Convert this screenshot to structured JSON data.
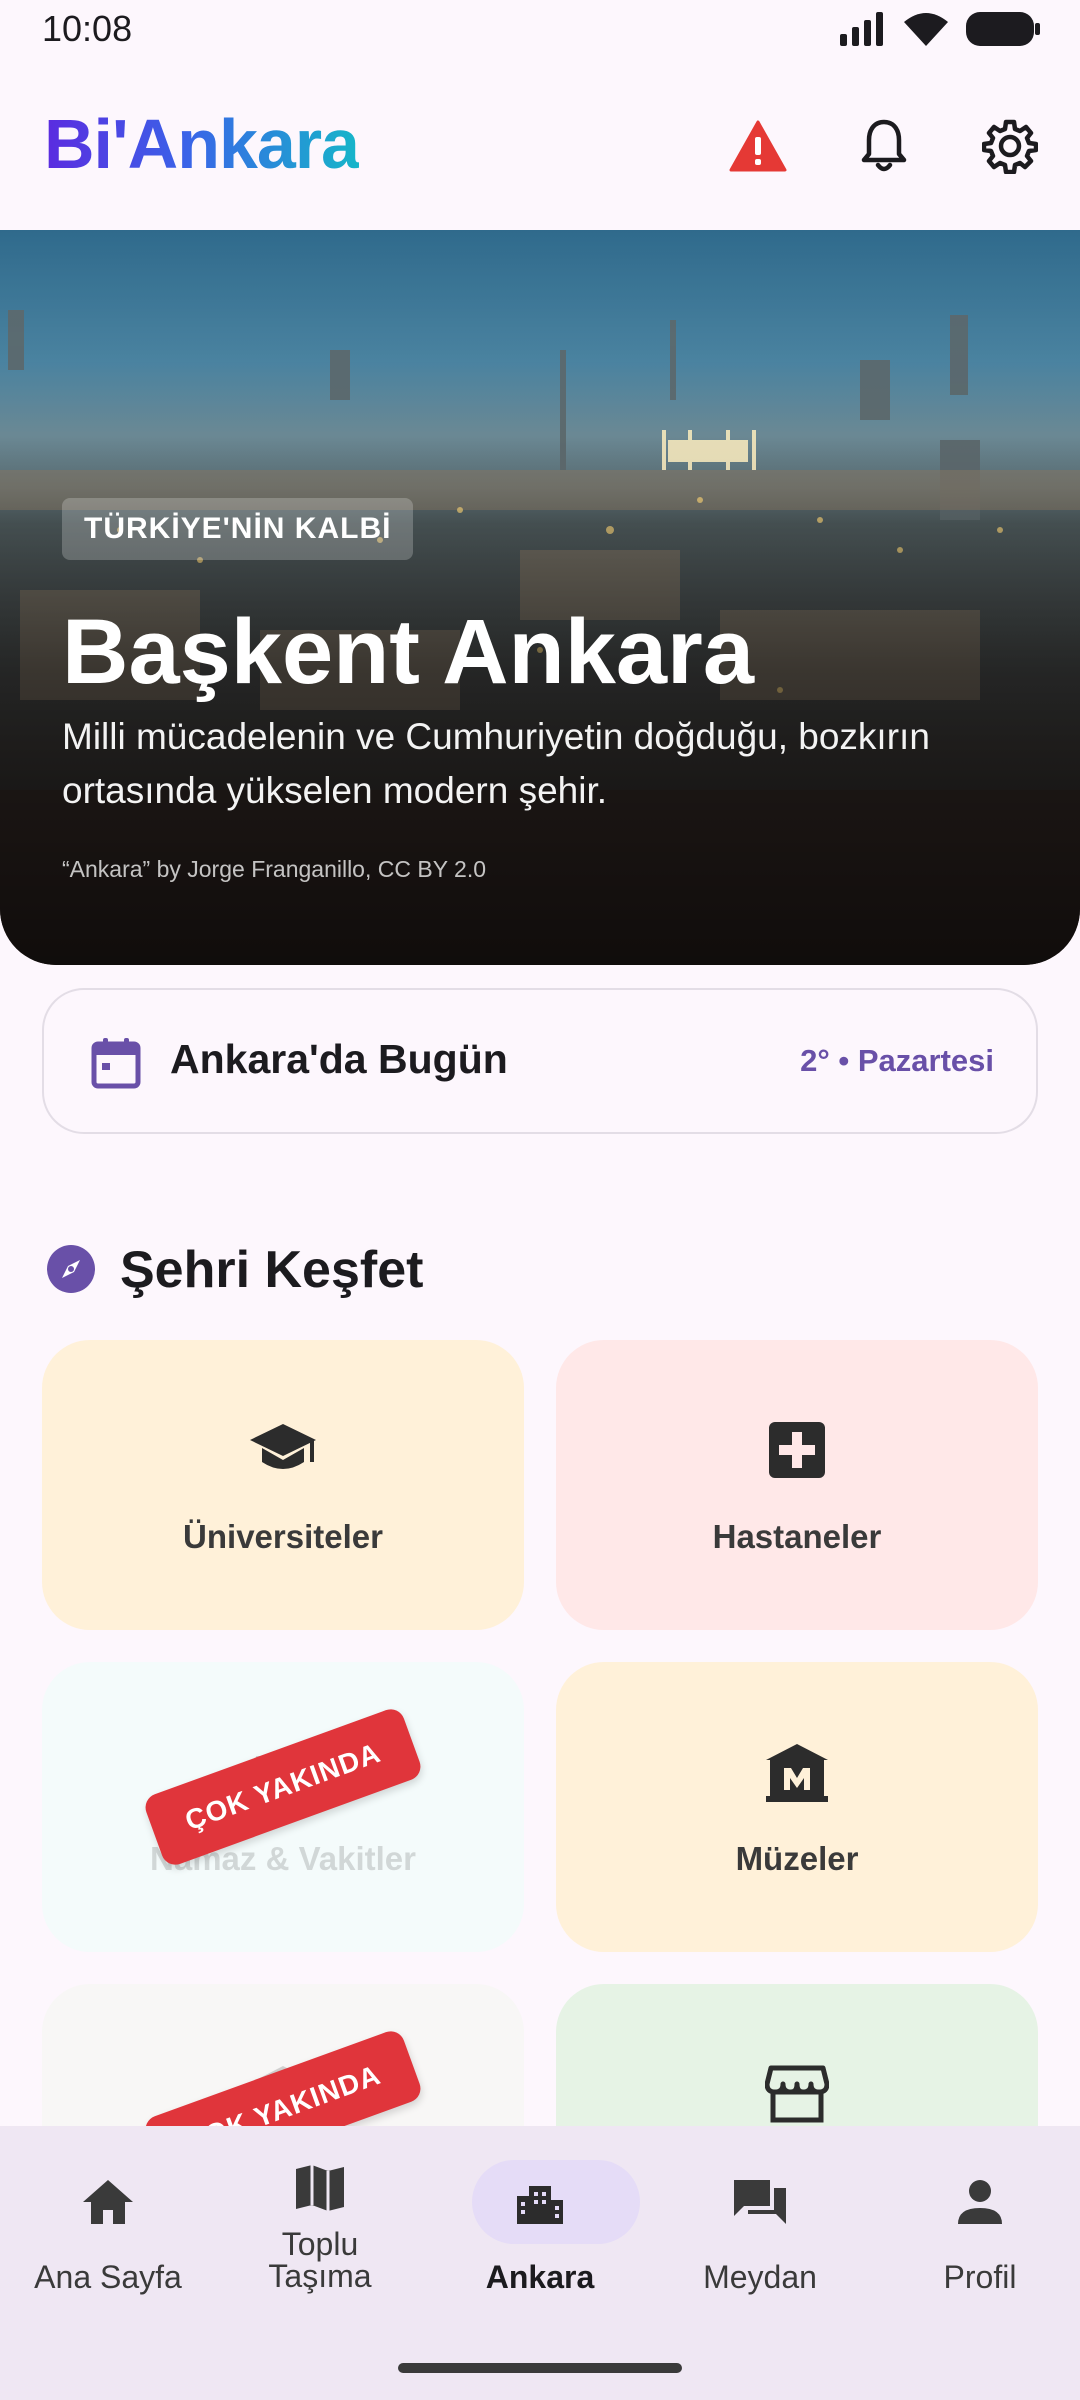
{
  "status_bar": {
    "time": "10:08"
  },
  "app_bar": {
    "logo": "Bi'Ankara",
    "actions": {
      "alert_icon": "warning-triangle-icon",
      "notifications_icon": "bell-icon",
      "settings_icon": "gear-icon"
    }
  },
  "hero": {
    "tag": "TÜRKİYE'NİN KALBİ",
    "title": "Başkent Ankara",
    "subtitle": "Milli mücadelenin ve Cumhuriyetin doğduğu, bozkırın ortasında yükselen modern şehir.",
    "credit": "“Ankara” by Jorge Franganillo, CC BY 2.0"
  },
  "today": {
    "title": "Ankara'da Bugün",
    "meta": "2° • Pazartesi"
  },
  "explore": {
    "title": "Şehri Keşfet",
    "tiles": [
      {
        "label": "Üniversiteler",
        "icon": "graduation-cap-icon",
        "bg": "#fff1d9"
      },
      {
        "label": "Hastaneler",
        "icon": "medical-cross-icon",
        "bg": "#ffe8e8"
      },
      {
        "label": "Namaz & Vakitler",
        "icon": "mosque-icon",
        "bg": "#f4fbfb",
        "badge": "ÇOK YAKINDA"
      },
      {
        "label": "Müzeler",
        "icon": "museum-icon",
        "bg": "#fff1d9"
      },
      {
        "label": "",
        "icon": "library-icon",
        "bg": "#f8f7f6",
        "badge": "ÇOK YAKINDA"
      },
      {
        "label": "",
        "icon": "store-icon",
        "bg": "#e6f3e5"
      }
    ]
  },
  "bottom_nav": {
    "items": [
      {
        "label": "Ana Sayfa",
        "icon": "home-icon"
      },
      {
        "label": "Toplu\nTaşıma",
        "icon": "map-icon"
      },
      {
        "label": "Ankara",
        "icon": "city-icon",
        "active": true
      },
      {
        "label": "Meydan",
        "icon": "forum-icon"
      },
      {
        "label": "Profil",
        "icon": "person-icon"
      }
    ]
  },
  "colors": {
    "accent": "#6950a8",
    "alert": "#e53935",
    "ribbon": "#e0353b"
  }
}
